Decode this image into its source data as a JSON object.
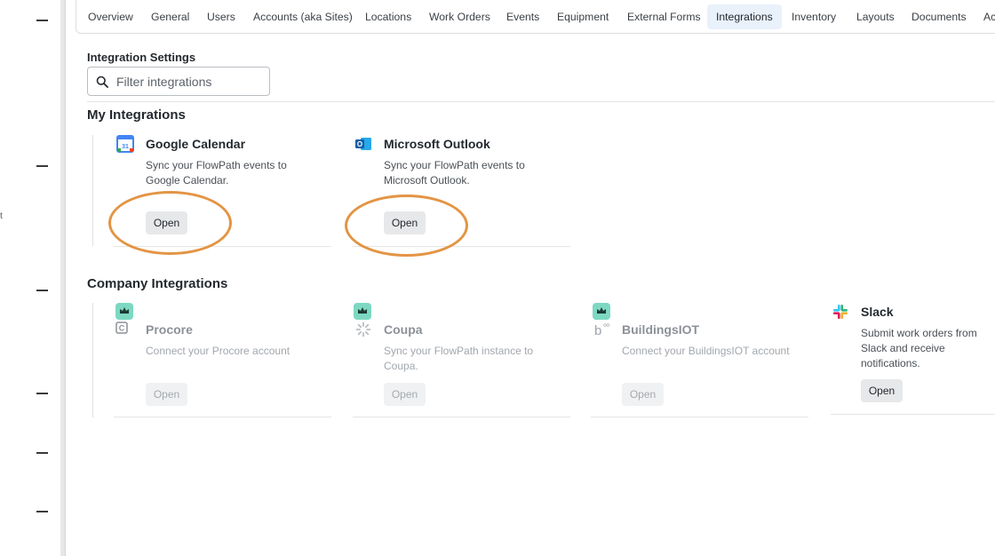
{
  "sidebar": {
    "stray_char": "t"
  },
  "tabs": [
    {
      "label": "Overview"
    },
    {
      "label": "General"
    },
    {
      "label": "Users"
    },
    {
      "label": "Accounts (aka Sites)"
    },
    {
      "label": "Locations"
    },
    {
      "label": "Work Orders"
    },
    {
      "label": "Events"
    },
    {
      "label": "Equipment"
    },
    {
      "label": "External Forms"
    },
    {
      "label": "Integrations",
      "active": true
    },
    {
      "label": "Inventory"
    },
    {
      "label": "Layouts"
    },
    {
      "label": "Documents"
    },
    {
      "label": "Ac"
    }
  ],
  "settings": {
    "title": "Integration Settings",
    "search_placeholder": "Filter integrations"
  },
  "my_integrations": {
    "title": "My Integrations",
    "cards": [
      {
        "name": "Google Calendar",
        "icon": "google-calendar-icon",
        "icon_text": "31",
        "description": "Sync your FlowPath events to Google Calendar.",
        "button": "Open"
      },
      {
        "name": "Microsoft Outlook",
        "icon": "microsoft-outlook-icon",
        "icon_text": "O",
        "description": "Sync your FlowPath events to Microsoft Outlook.",
        "button": "Open"
      }
    ]
  },
  "company_integrations": {
    "title": "Company Integrations",
    "cards": [
      {
        "name": "Procore",
        "icon": "procore-icon",
        "icon_text": "C",
        "description": "Connect your Procore account",
        "button": "Open",
        "premium": true,
        "disabled": true
      },
      {
        "name": "Coupa",
        "icon": "coupa-icon",
        "description": "Sync your FlowPath instance to Coupa.",
        "button": "Open",
        "premium": true,
        "disabled": true
      },
      {
        "name": "BuildingsIOT",
        "icon": "buildingsiot-icon",
        "icon_text": "b",
        "description": "Connect your BuildingsIOT account",
        "button": "Open",
        "premium": true,
        "disabled": true
      },
      {
        "name": "Slack",
        "icon": "slack-icon",
        "description": "Submit work orders from Slack and receive notifications.",
        "button": "Open",
        "premium": false,
        "disabled": false
      }
    ]
  },
  "colors": {
    "accent_ring": "#e39444",
    "active_tab_bg": "#e9f1fb",
    "premium_badge": "#7dd8c2"
  }
}
